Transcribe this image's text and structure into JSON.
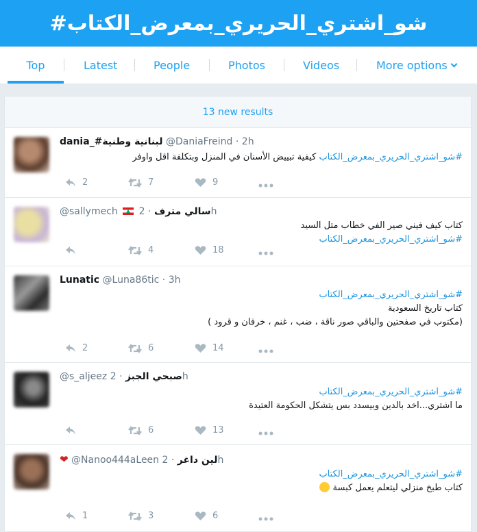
{
  "header": {
    "title": "#شو_اشتري_الحريري_بمعرض_الكتاب"
  },
  "tabs": [
    {
      "label": "Top"
    },
    {
      "label": "Latest"
    },
    {
      "label": "People"
    },
    {
      "label": "Photos"
    },
    {
      "label": "Videos"
    },
    {
      "label": "More options"
    }
  ],
  "timeline": {
    "new_results": "13 new results"
  },
  "tweets": [
    {
      "name": "dania_#لبنانية وطنية",
      "handle": "@DaniaFreind",
      "time": "2h",
      "hashtag": "#شو_اشتري_الحريري_بمعرض_الكتاب",
      "text": "كيفية تبييض الأسنان في المنزل وبتكلفة اقل واوفر",
      "replies": "2",
      "retweets": "7",
      "likes": "9"
    },
    {
      "name": "سالي مترف",
      "handle": "@sallymech",
      "time": "2h",
      "text": "كتاب كيف فيني صير الفي خطاب متل السيد",
      "hashtag": "#شو_اشتري_الحريري_بمعرض_الكتاب",
      "replies": "",
      "retweets": "4",
      "likes": "18"
    },
    {
      "name": "Lunatic",
      "handle": "@Luna86tic",
      "time": "3h",
      "hashtag": "#شو_اشتري_الحريري_بمعرض_الكتاب",
      "line1": "كتاب تاريخ السعودية",
      "line2": "(مكتوب في صفحتين والباقي صور ناقة ، ضب ، غنم ، خرفان و قرود )",
      "replies": "2",
      "retweets": "6",
      "likes": "14"
    },
    {
      "name": "صبحي الجبز",
      "handle": "@s_aljeez",
      "time": "2h",
      "hashtag": "#شو_اشتري_الحريري_بمعرض_الكتاب",
      "text": "ما اشتري...اخد بالدين وبيسدد بس يتشكل الحكومة العتيدة",
      "replies": "",
      "retweets": "6",
      "likes": "13"
    },
    {
      "name": "لين داغر",
      "handle": "@Nanoo444aLeen",
      "time": "2h",
      "hashtag": "#شو_اشتري_الحريري_بمعرض_الكتاب",
      "text": "كتاب طبخ منزلي ليتعلم يعمل كبسة",
      "replies": "1",
      "retweets": "3",
      "likes": "6"
    }
  ],
  "colors": {
    "brand": "#1da1f2",
    "link": "#1b95e0",
    "muted": "#657786",
    "background": "#e6ecf0"
  }
}
